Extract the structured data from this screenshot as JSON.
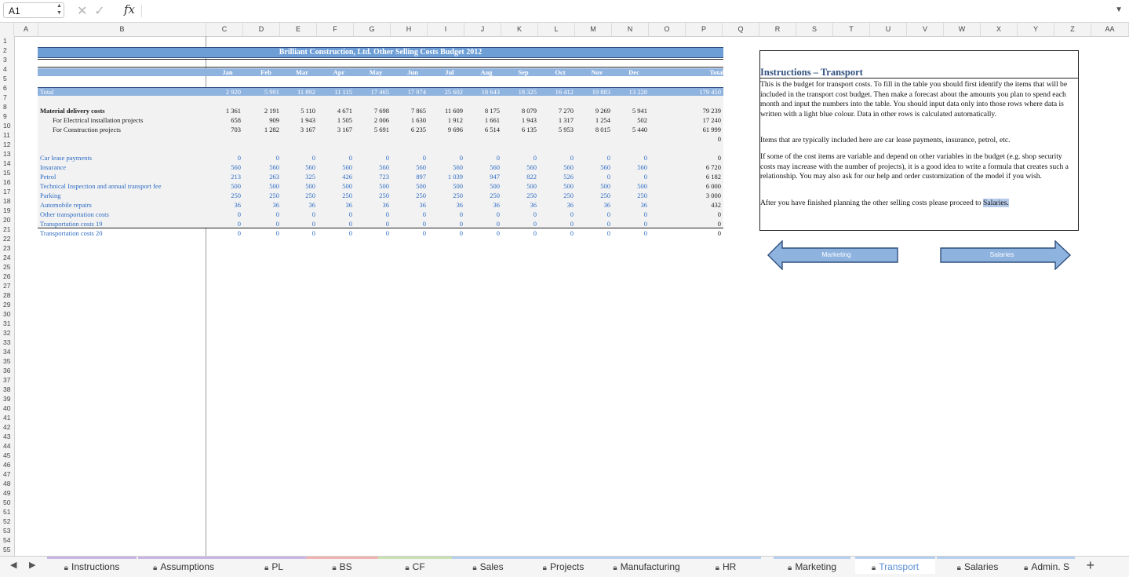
{
  "formula_bar": {
    "cell_ref": "A1",
    "fx_label": "fx",
    "formula": ""
  },
  "columns": [
    "A",
    "B",
    "C",
    "D",
    "E",
    "F",
    "G",
    "H",
    "I",
    "J",
    "K",
    "L",
    "M",
    "N",
    "O",
    "P",
    "Q",
    "R",
    "S",
    "T",
    "U",
    "V",
    "W",
    "X",
    "Y",
    "Z",
    "AA"
  ],
  "rows_count": 55,
  "sheet": {
    "title": "Brilliant Construction, Ltd. Other Selling Costs Budget 2012",
    "months": [
      "Jan",
      "Feb",
      "Mar",
      "Apr",
      "May",
      "Jun",
      "Jul",
      "Aug",
      "Sep",
      "Oct",
      "Nov",
      "Dec"
    ],
    "total_header": "Total",
    "total_row": {
      "label": "Total",
      "values": [
        "2 920",
        "5 991",
        "11 892",
        "11 115",
        "17 465",
        "17 974",
        "25 602",
        "18 643",
        "18 325",
        "16 412",
        "19 883",
        "13 228"
      ],
      "total": "179 450"
    },
    "rows": [
      {
        "label": "Material delivery costs",
        "values": [
          "1 361",
          "2 191",
          "5 110",
          "4 671",
          "7 698",
          "7 865",
          "11 609",
          "8 175",
          "8 079",
          "7 270",
          "9 269",
          "5 941"
        ],
        "total": "79 239",
        "style": "bold"
      },
      {
        "label": "For Electrical installation projects",
        "values": [
          "658",
          "909",
          "1 943",
          "1 505",
          "2 006",
          "1 630",
          "1 912",
          "1 661",
          "1 943",
          "1 317",
          "1 254",
          "502"
        ],
        "total": "17 240",
        "style": "indent"
      },
      {
        "label": "For Construction projects",
        "values": [
          "703",
          "1 282",
          "3 167",
          "3 167",
          "5 691",
          "6 235",
          "9 696",
          "6 514",
          "6 135",
          "5 953",
          "8 015",
          "5 440"
        ],
        "total": "61 999",
        "style": "indent"
      },
      {
        "label": "",
        "values": [
          "",
          "",
          "",
          "",
          "",
          "",
          "",
          "",
          "",
          "",
          "",
          ""
        ],
        "total": "0",
        "style": "plain"
      },
      {
        "label": "Car lease payments",
        "values": [
          "0",
          "0",
          "0",
          "0",
          "0",
          "0",
          "0",
          "0",
          "0",
          "0",
          "0",
          "0"
        ],
        "total": "0",
        "style": "blue"
      },
      {
        "label": "Insurance",
        "values": [
          "560",
          "560",
          "560",
          "560",
          "560",
          "560",
          "560",
          "560",
          "560",
          "560",
          "560",
          "560"
        ],
        "total": "6 720",
        "style": "blue"
      },
      {
        "label": "Petrol",
        "values": [
          "213",
          "263",
          "325",
          "426",
          "723",
          "897",
          "1 039",
          "947",
          "822",
          "526",
          "0",
          "0"
        ],
        "total": "6 182",
        "style": "blue"
      },
      {
        "label": "Technical Inspection and annual transport fee",
        "values": [
          "500",
          "500",
          "500",
          "500",
          "500",
          "500",
          "500",
          "500",
          "500",
          "500",
          "500",
          "500"
        ],
        "total": "6 000",
        "style": "blue"
      },
      {
        "label": "Parking",
        "values": [
          "250",
          "250",
          "250",
          "250",
          "250",
          "250",
          "250",
          "250",
          "250",
          "250",
          "250",
          "250"
        ],
        "total": "3 000",
        "style": "blue"
      },
      {
        "label": "Automobile repairs",
        "values": [
          "36",
          "36",
          "36",
          "36",
          "36",
          "36",
          "36",
          "36",
          "36",
          "36",
          "36",
          "36"
        ],
        "total": "432",
        "style": "blue"
      },
      {
        "label": "Other transportation costs",
        "values": [
          "0",
          "0",
          "0",
          "0",
          "0",
          "0",
          "0",
          "0",
          "0",
          "0",
          "0",
          "0"
        ],
        "total": "0",
        "style": "blue"
      },
      {
        "label": "Transportation costs 19",
        "values": [
          "0",
          "0",
          "0",
          "0",
          "0",
          "0",
          "0",
          "0",
          "0",
          "0",
          "0",
          "0"
        ],
        "total": "0",
        "style": "blue"
      },
      {
        "label": "Transportation costs 20",
        "values": [
          "0",
          "0",
          "0",
          "0",
          "0",
          "0",
          "0",
          "0",
          "0",
          "0",
          "0",
          "0"
        ],
        "total": "0",
        "style": "blue"
      }
    ]
  },
  "instructions": {
    "title": "Instructions – Transport",
    "p1": "This is the budget for transport costs. To fill in the table you should first identify the items that will be included in the transport cost budget. Then make a forecast about the amounts you plan to spend each month and input the numbers into the table. You should input data only into those rows where data is written with a light blue colour. Data in other rows is calculated automatically.",
    "p2": "Items that are typically included here are car lease payments, insurance, petrol, etc.",
    "p3": "If some of the cost items are variable and depend on other variables in the budget (e.g. shop security costs may increase with the number of projects), it is a good idea to write a formula that creates such a relationship. You may also ask for our help and order customization of the model if you wish.",
    "p4_pre": "After you have finished planning the other selling costs please proceed to ",
    "p4_link": "Salaries."
  },
  "nav_buttons": {
    "back": "Marketing",
    "next": "Salaries"
  },
  "colors": {
    "band": "#8fb3df",
    "title_band": "#6d9ed6",
    "input_text": "#2e6cc4",
    "arrow_fill": "#8fb3df",
    "arrow_stroke": "#2f4f7f"
  },
  "tabs": [
    {
      "label": "Instructions"
    },
    {
      "label": "Assumptions"
    },
    {
      "label": "PL"
    },
    {
      "label": "BS"
    },
    {
      "label": "CF"
    },
    {
      "label": "Sales"
    },
    {
      "label": "Projects"
    },
    {
      "label": "Manufacturing"
    },
    {
      "label": "HR"
    },
    {
      "label": "Marketing"
    },
    {
      "label": "Transport",
      "active": true
    },
    {
      "label": "Salaries"
    },
    {
      "label": "Admin. S"
    }
  ],
  "tab_add": "+"
}
